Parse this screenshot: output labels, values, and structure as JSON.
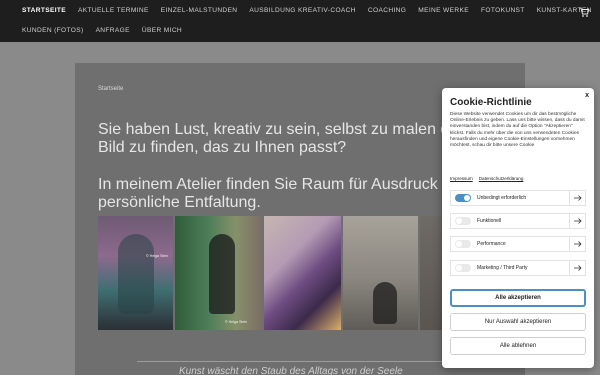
{
  "nav": {
    "row1": [
      "STARTSEITE",
      "AKTUELLE TERMINE",
      "EINZEL-MALSTUNDEN",
      "AUSBILDUNG KREATIV-COACH",
      "COACHING",
      "MEINE WERKE",
      "FOTOKUNST",
      "KUNST-KARTEN"
    ],
    "row2": [
      "KUNDEN (FOTOS)",
      "ANFRAGE",
      "ÜBER MICH"
    ],
    "active_index": 0,
    "cart_icon": "shopping-cart-icon"
  },
  "page": {
    "breadcrumb": "Startseite",
    "headline_1": "Sie haben Lust, kreativ zu sein, selbst zu malen oder ein Bild zu finden, das zu Ihnen passt?",
    "headline_2": "In meinem Atelier finden Sie Raum für Ausdruck und persönliche Entfaltung.",
    "photo_caption_1": "© Helga Stein",
    "photo_caption_2": "© Helga Stein",
    "footer_quote": "Kunst wäscht den Staub des Alltags von der Seele"
  },
  "cookie": {
    "title": "Cookie-Richtlinie",
    "close_label": "x",
    "text": "Diese Website verwendet Cookies um dir das bestmögliche Online-Erlebnis zu geben. Lass uns bitte wissen, dass du damit einverstanden bist, indem du auf die Option \"Akzeptieren\" klickst. Falls du mehr über die von uns verwendeten Cookies herausfinden und eigene Cookie-Einstellungen vornehmen möchtest, schau dir bitte unsere Cookie",
    "link_imprint": "Impressum",
    "link_privacy": "Datenschutzerklärung",
    "categories": [
      {
        "label": "Unbedingt erforderlich",
        "enabled": true
      },
      {
        "label": "Funktionell",
        "enabled": false
      },
      {
        "label": "Performance",
        "enabled": false
      },
      {
        "label": "Marketing / Third Party",
        "enabled": false
      }
    ],
    "btn_accept_all": "Alle akzeptieren",
    "btn_accept_selection": "Nur Auswahl akzeptieren",
    "btn_reject_all": "Alle ablehnen"
  },
  "colors": {
    "nav_bg": "#1e1e1e",
    "overlay": "#8a8a8a",
    "toggle_on": "#4a90c8"
  }
}
